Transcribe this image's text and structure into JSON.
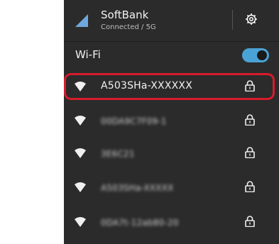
{
  "carrier": {
    "name": "SoftBank",
    "status": "Connected / 5G"
  },
  "wifi": {
    "label": "Wi-Fi",
    "enabled": true
  },
  "networks": [
    {
      "ssid": "A503SHa-XXXXXX",
      "highlighted": true,
      "obscured": false
    },
    {
      "ssid": "00DA9C7F09-1",
      "highlighted": false,
      "obscured": true
    },
    {
      "ssid": "3E6C21",
      "highlighted": false,
      "obscured": true
    },
    {
      "ssid": "A503SHa-XXXXX",
      "highlighted": false,
      "obscured": true
    },
    {
      "ssid": "0DA7t-12ab80-20",
      "highlighted": false,
      "obscured": true
    }
  ],
  "colors": {
    "panel": "#2b2b2b",
    "accent": "#4aa3d6",
    "highlight": "#d81b2b"
  },
  "icons": {
    "signal": "signal-triangle-icon",
    "settings": "gear-icon",
    "wifi": "wifi-icon",
    "lock": "lock-icon"
  }
}
